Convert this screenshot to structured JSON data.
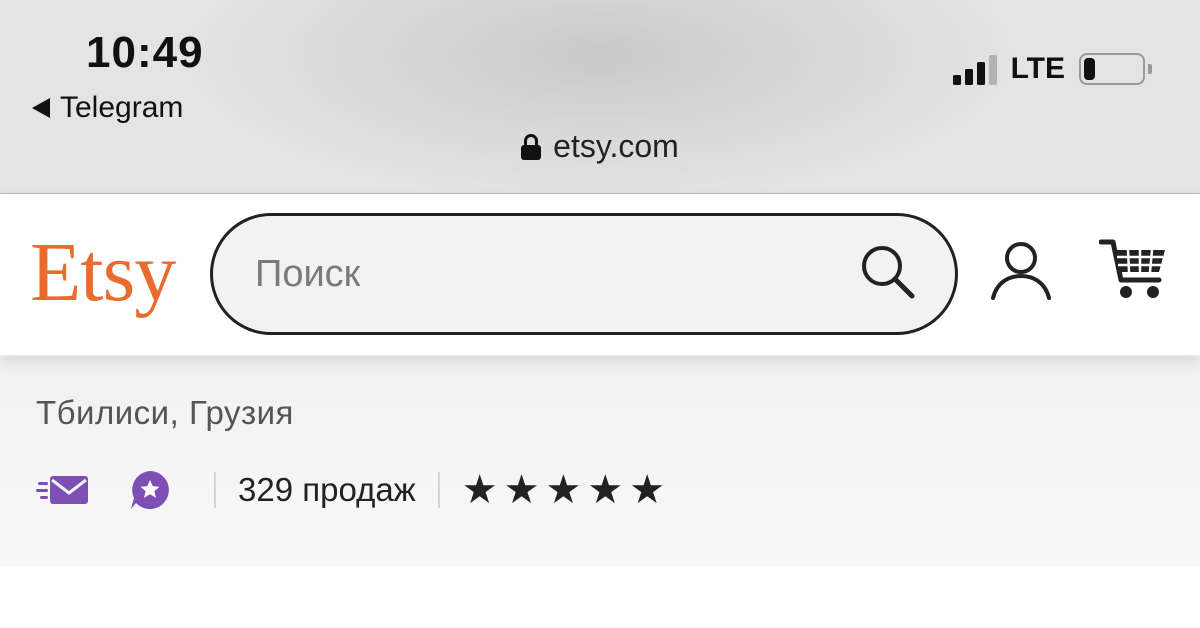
{
  "status_bar": {
    "time": "10:49",
    "back_app": "Telegram",
    "network": "LTE",
    "signal_bars": 3,
    "battery_level_percent": 20
  },
  "browser": {
    "url": "etsy.com"
  },
  "header": {
    "logo": "Etsy",
    "search_placeholder": "Поиск"
  },
  "shop": {
    "location": "Тбилиси, Грузия",
    "sales": "329 продаж",
    "rating": 5
  },
  "colors": {
    "brand": "#e96c2e",
    "badge_purple": "#7d4fb5"
  },
  "icons": [
    "lock-icon",
    "search-icon",
    "user-icon",
    "cart-icon",
    "fast-mail-icon",
    "star-badge-icon",
    "star-icon"
  ]
}
